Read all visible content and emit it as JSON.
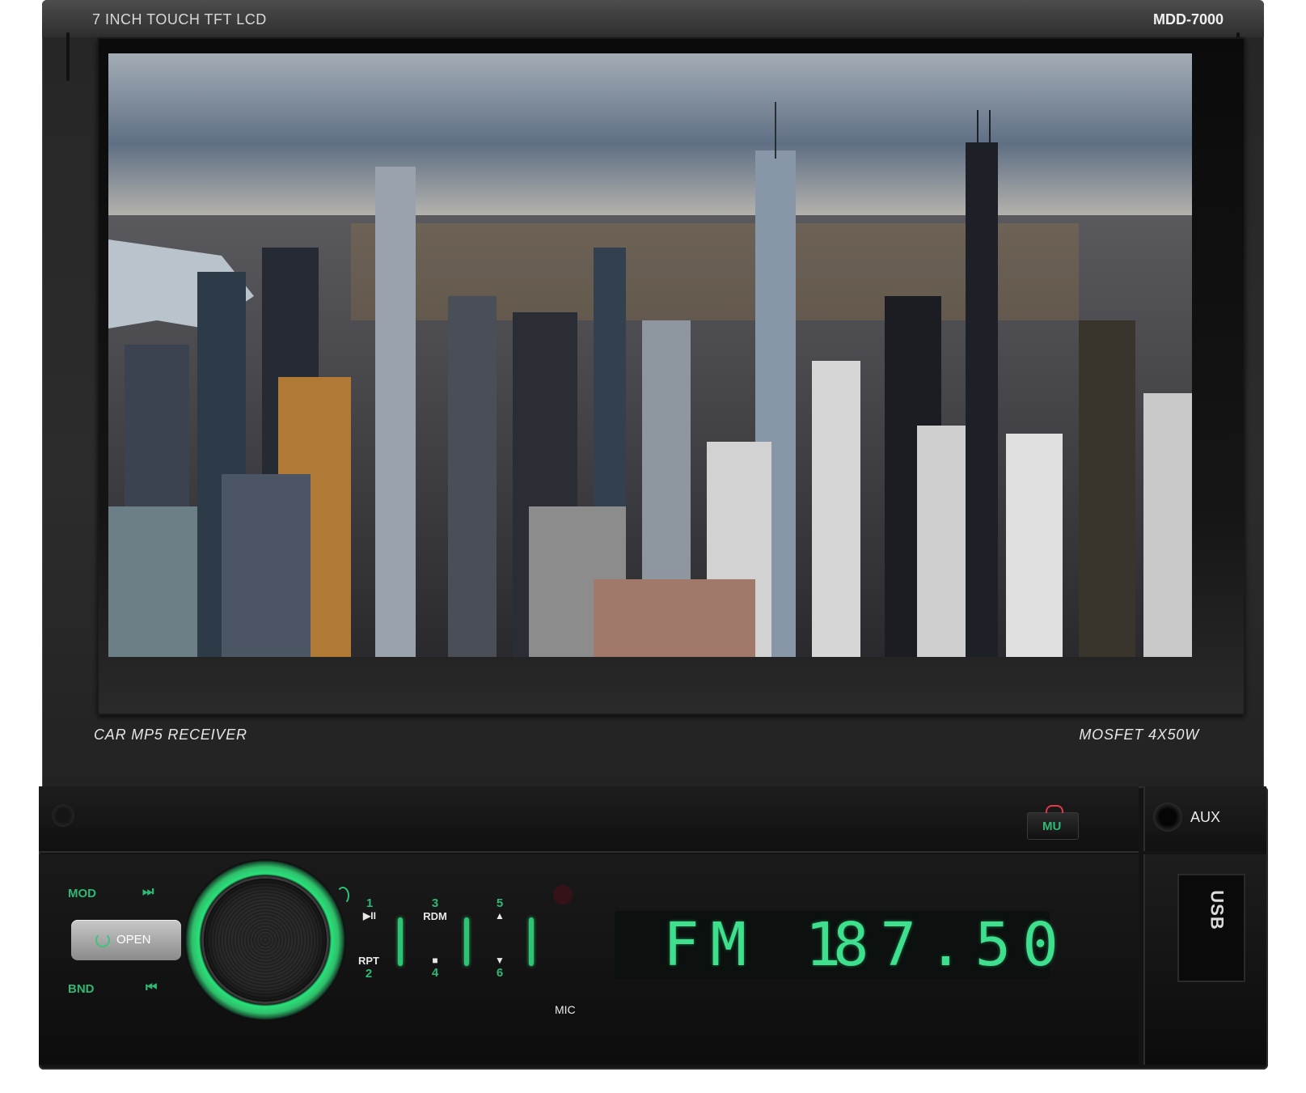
{
  "screen": {
    "top_left_label": "7 INCH TOUCH TFT LCD",
    "model": "MDD-7000",
    "bottom_left_label": "CAR MP5 RECEIVER",
    "bottom_right_label": "MOSFET  4X50W"
  },
  "controls": {
    "mod_label": "MOD",
    "bnd_label": "BND",
    "next_icon": "⏭",
    "prev_icon": "⏮",
    "open_label": "OPEN",
    "presets": [
      {
        "num": "1",
        "sub": "▶II"
      },
      {
        "num": "2",
        "sub": "RPT"
      },
      {
        "num": "3",
        "sub": "RDM"
      },
      {
        "num": "4",
        "sub": "■"
      },
      {
        "num": "5",
        "sub": "▲"
      },
      {
        "num": "6",
        "sub": "▼"
      }
    ],
    "mu_label": "MU",
    "aux_label": "AUX",
    "mic_label": "MIC",
    "usb_label": "USB"
  },
  "display": {
    "band": "FM 1",
    "frequency": "87.50"
  },
  "colors": {
    "accent_green": "#2fc474",
    "lcd_text": "#3ee08e"
  }
}
